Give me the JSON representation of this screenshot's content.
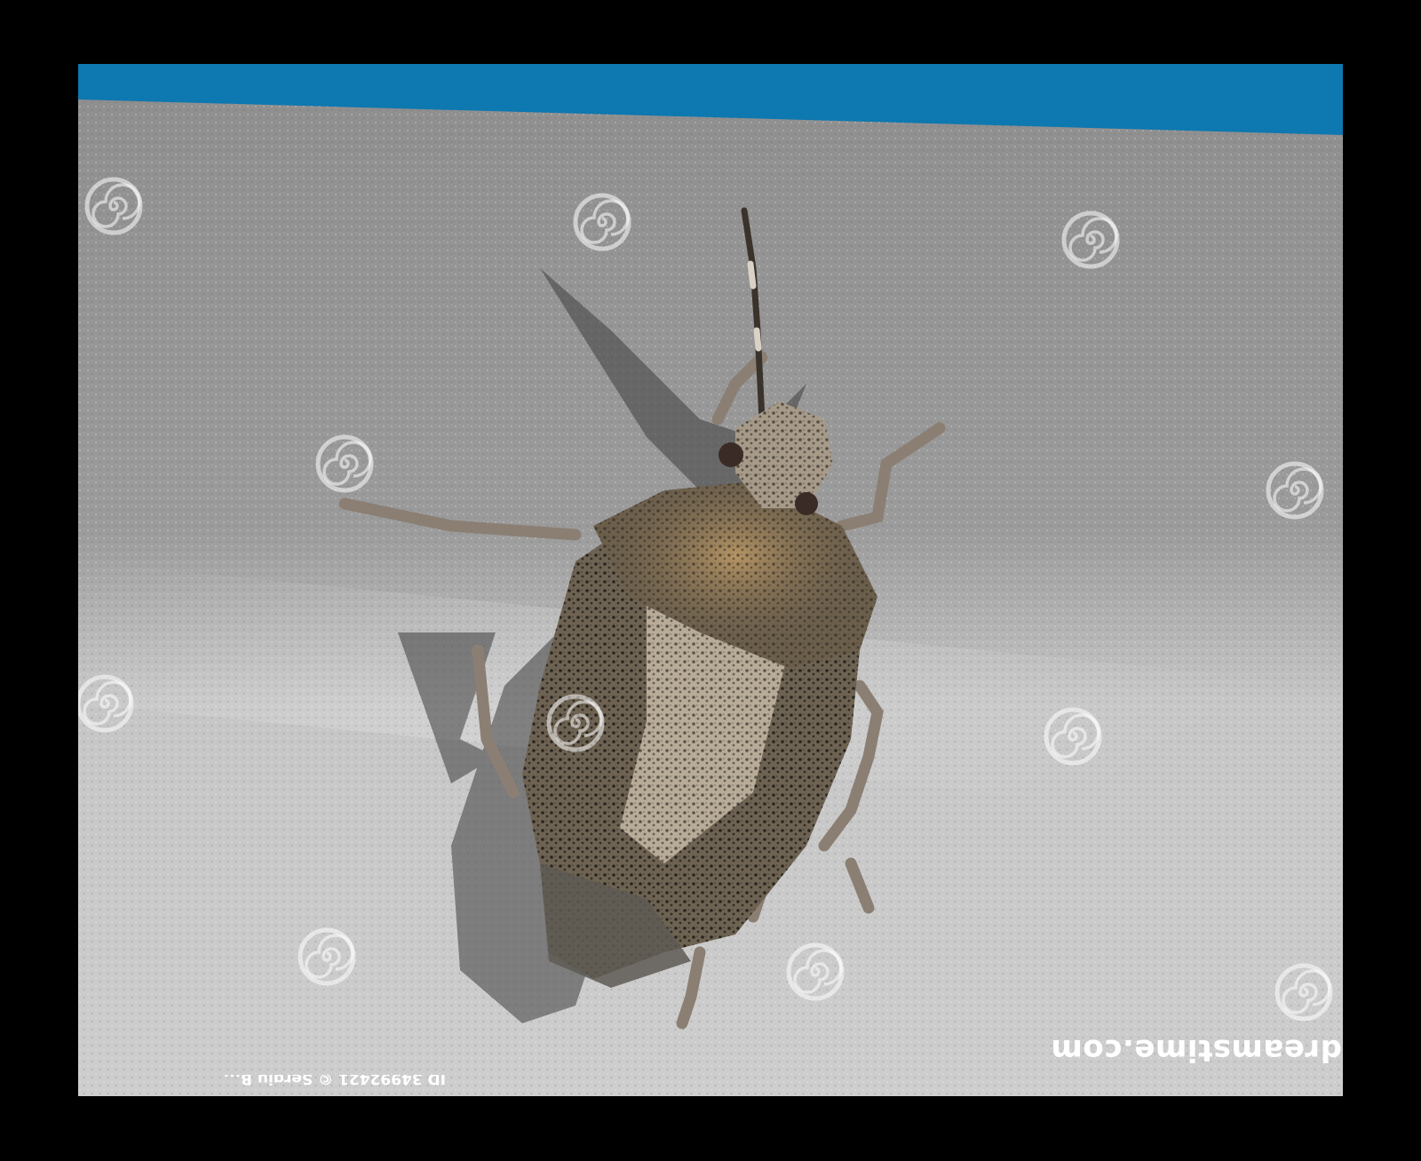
{
  "image": {
    "subject": "stink-bug",
    "background": "sandy-grey-surface"
  },
  "watermark": {
    "brand_text": "dreamstime.com",
    "credit_text": "ID 34992421 © Sergiu B...",
    "banner_color": "#0e78b0",
    "icon": "dreamstime-spiral-icon"
  },
  "colors": {
    "frame": "#000000",
    "surface_light": "#c9c9c9",
    "surface_dark": "#8c8c8c",
    "bug_body": "#6e6352",
    "bug_spots": "#1c1a17"
  }
}
